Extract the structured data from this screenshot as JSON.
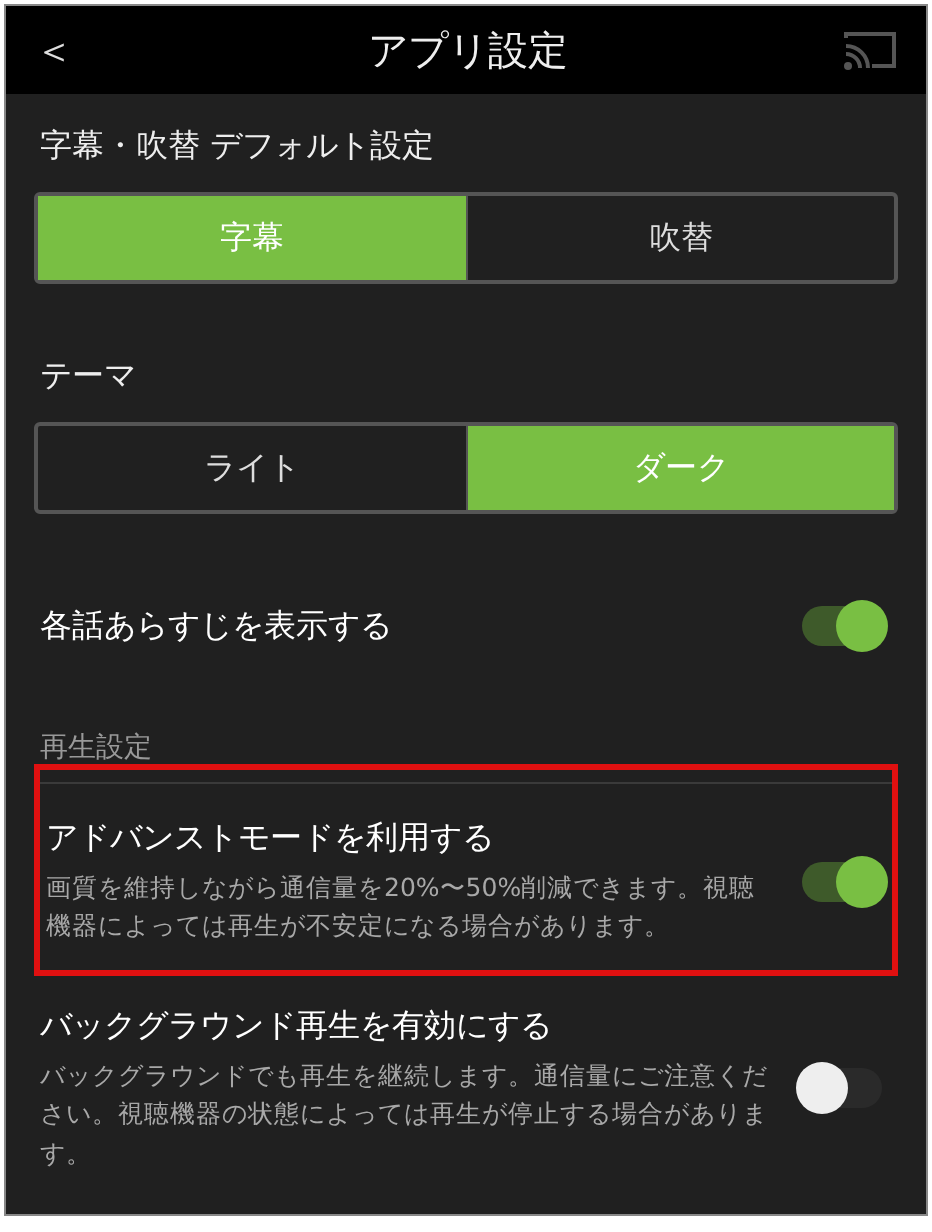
{
  "header": {
    "back": "＜",
    "title": "アプリ設定"
  },
  "sections": [
    {
      "kind": "segmented",
      "label": "字幕・吹替 デフォルト設定",
      "options": [
        {
          "label": "字幕",
          "selected": true
        },
        {
          "label": "吹替",
          "selected": false
        }
      ]
    },
    {
      "kind": "segmented",
      "label": "テーマ",
      "options": [
        {
          "label": "ライト",
          "selected": false
        },
        {
          "label": "ダーク",
          "selected": true
        }
      ]
    },
    {
      "kind": "toggle",
      "title": "各話あらすじを表示する",
      "on": true,
      "highlighted": false
    },
    {
      "kind": "heading",
      "label": "再生設定"
    },
    {
      "kind": "toggle",
      "title": "アドバンストモードを利用する",
      "description": "画質を維持しながら通信量を20%〜50%削減できます。視聴機器によっては再生が不安定になる場合があります。",
      "on": true,
      "highlighted": true
    },
    {
      "kind": "toggle",
      "title": "バックグラウンド再生を有効にする",
      "description": "バックグラウンドでも再生を継続します。通信量にご注意ください。視聴機器の状態によっては再生が停止する場合があります。",
      "on": false,
      "highlighted": false
    }
  ]
}
